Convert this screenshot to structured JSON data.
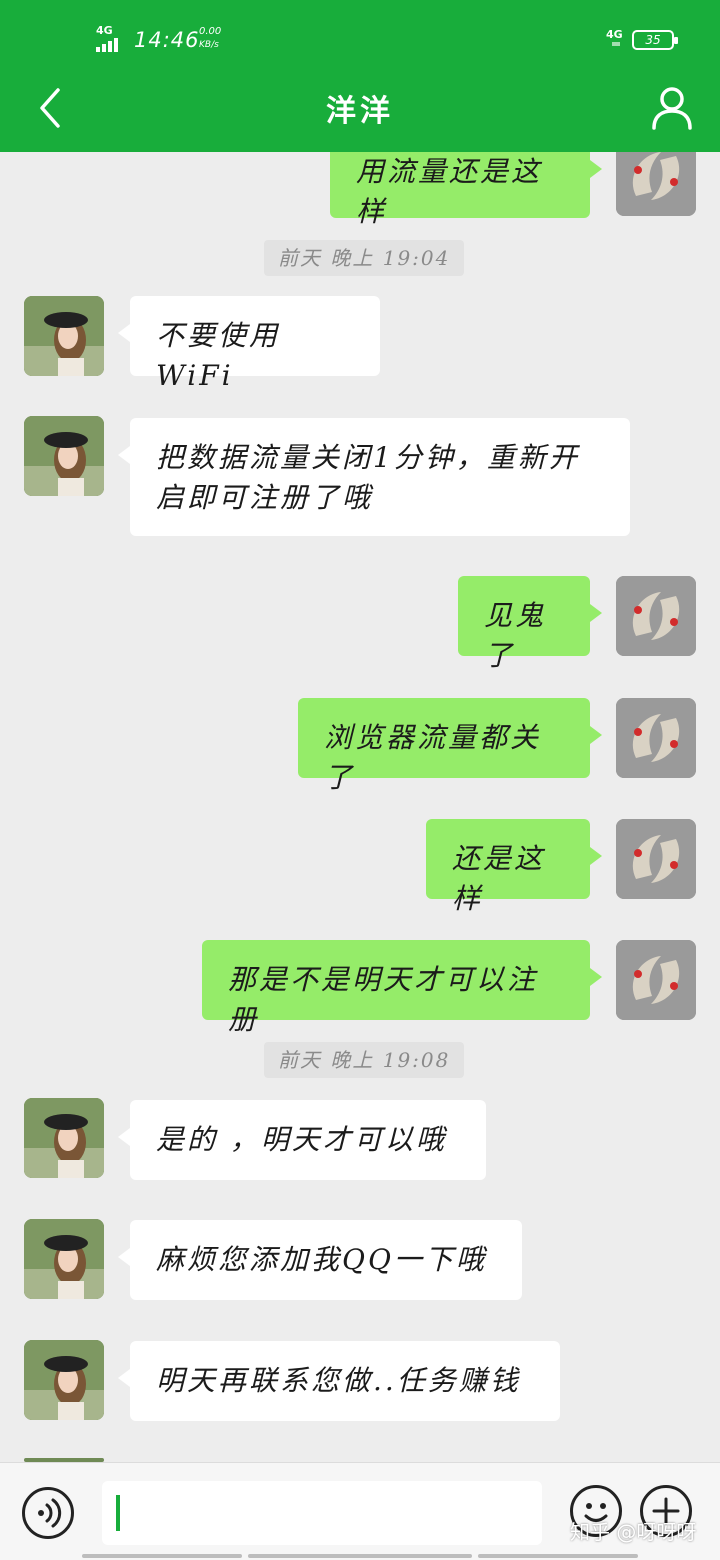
{
  "status_bar": {
    "network_left": "4G",
    "time": "14:46",
    "speed_value": "0.00",
    "speed_unit": "KB/s",
    "network_right": "4G",
    "battery": "35"
  },
  "header": {
    "title": "洋洋",
    "back_icon": "chevron-left-icon",
    "profile_icon": "person-icon"
  },
  "messages": [
    {
      "side": "out",
      "text": "用流量还是这样"
    },
    {
      "type": "stamp",
      "text": "前天 晚上 19:04"
    },
    {
      "side": "in",
      "text": "不要使用WiFi"
    },
    {
      "side": "in",
      "text": "把数据流量关闭1分钟，重新开启即可注册了哦"
    },
    {
      "side": "out",
      "text": "见鬼了"
    },
    {
      "side": "out",
      "text": "浏览器流量都关了"
    },
    {
      "side": "out",
      "text": "还是这样"
    },
    {
      "side": "out",
      "text": "那是不是明天才可以注册"
    },
    {
      "type": "stamp",
      "text": "前天 晚上 19:08"
    },
    {
      "side": "in",
      "text": "是的 ，明天才可以哦"
    },
    {
      "side": "in",
      "text": "麻烦您添加我QQ一下哦"
    },
    {
      "side": "in",
      "text": "明天再联系您做..任务赚钱"
    }
  ],
  "input_bar": {
    "voice_icon": "voice-icon",
    "emoji_icon": "emoji-icon",
    "plus_icon": "plus-icon",
    "input_value": ""
  },
  "watermark": "知乎 @呀呀呀",
  "colors": {
    "header": "#18ad3b",
    "outgoing_bubble": "#95ec69",
    "incoming_bubble": "#ffffff",
    "background": "#ededed"
  }
}
